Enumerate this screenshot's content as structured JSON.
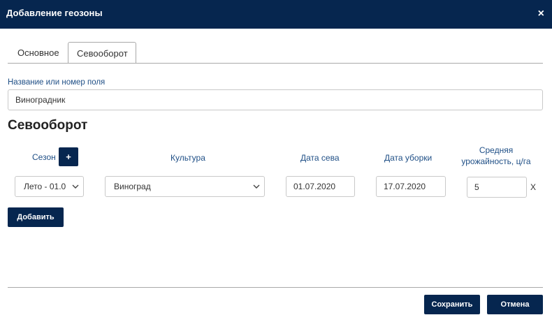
{
  "dialog": {
    "title": "Добавление геозоны",
    "close_label": "×"
  },
  "tabs": [
    {
      "label": "Основное",
      "active": false
    },
    {
      "label": "Севооборот",
      "active": true
    }
  ],
  "field": {
    "label": "Название или номер поля",
    "value": "Виноградник"
  },
  "section_title": "Севооборот",
  "columns": {
    "season": "Сезон",
    "add_season": "+",
    "culture": "Культура",
    "sowing_date": "Дата сева",
    "harvest_date": "Дата уборки",
    "yield_line1": "Средняя",
    "yield_line2": "урожайность, ц/га"
  },
  "row": {
    "season": "Лето - 01.0",
    "culture": "Виноград",
    "sowing_date": "01.07.2020",
    "harvest_date": "17.07.2020",
    "yield": "5",
    "remove": "X"
  },
  "buttons": {
    "add": "Добавить",
    "save": "Сохранить",
    "cancel": "Отмена"
  },
  "colors": {
    "primary": "#06264f",
    "label": "#1f4f86"
  }
}
